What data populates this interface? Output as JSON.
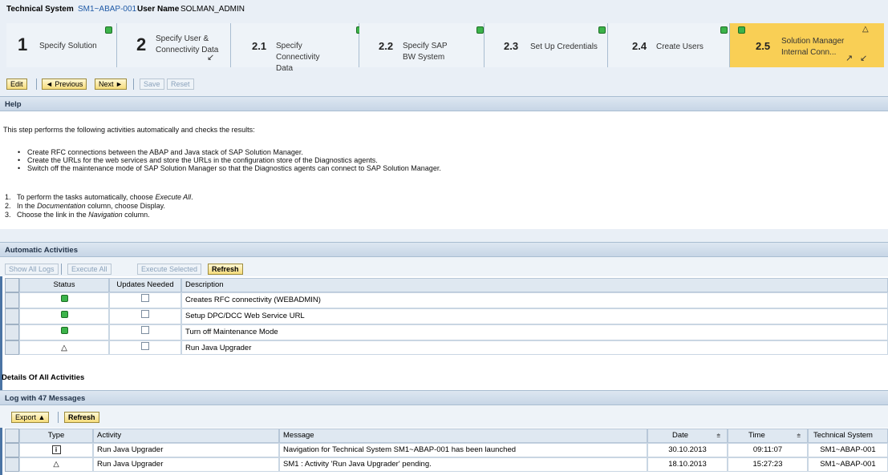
{
  "header": {
    "technical_system_label": "Technical System",
    "technical_system_value": "SM1~ABAP-001",
    "user_name_label": "User Name",
    "user_name_value": "SOLMAN_ADMIN"
  },
  "roadmap": [
    {
      "num": "1",
      "label": "Specify Solution",
      "status": "green"
    },
    {
      "num": "2",
      "label": "Specify User & Connectivity Data",
      "status": "warning"
    },
    {
      "num": "2.1",
      "label": "Specify Connectivity Data",
      "status": "green"
    },
    {
      "num": "2.2",
      "label": "Specify SAP BW System",
      "status": "green"
    },
    {
      "num": "2.3",
      "label": "Set Up Credentials",
      "status": "green"
    },
    {
      "num": "2.4",
      "label": "Create Users",
      "status": "green"
    },
    {
      "num": "2.5",
      "label": "Solution Manager Internal Conn...",
      "status": "warning",
      "active": true
    }
  ],
  "toolbar": {
    "edit": "Edit",
    "previous": "◄ Previous",
    "next": "Next ►",
    "save": "Save",
    "reset": "Reset"
  },
  "help": {
    "title": "Help",
    "intro": "This step performs the following activities automatically and checks the results:",
    "bullets": [
      "Create RFC connections between the ABAP and Java stack of SAP Solution Manager.",
      "Create the URLs for the web services and store the URLs in the configuration store of the Diagnostics agents.",
      "Switch off the maintenance mode of SAP Solution Manager so that the Diagnostics agents can connect to SAP Solution Manager."
    ],
    "steps": [
      {
        "n": "1.",
        "pre": "To perform the tasks automatically, choose ",
        "em": "Execute All",
        "post": "."
      },
      {
        "n": "2.",
        "pre": "In the ",
        "em": "Documentation",
        "post": " column, choose Display."
      },
      {
        "n": "3.",
        "pre": "Choose the link in the ",
        "em": "Navigation",
        "post": " column."
      }
    ]
  },
  "automatic": {
    "title": "Automatic Activities",
    "buttons": {
      "show_all_logs": "Show All Logs",
      "execute_all": "Execute All",
      "execute_selected": "Execute Selected",
      "refresh": "Refresh"
    },
    "columns": [
      "Status",
      "Updates Needed",
      "Description"
    ],
    "rows": [
      {
        "status": "green",
        "description": "Creates RFC connectivity (WEBADMIN)"
      },
      {
        "status": "green",
        "description": "Setup DPC/DCC Web Service URL"
      },
      {
        "status": "green",
        "description": "Turn off Maintenance Mode"
      },
      {
        "status": "warning",
        "description": "Run Java Upgrader"
      }
    ]
  },
  "details_title": "Details Of All Activities",
  "log": {
    "title": "Log with 47 Messages",
    "buttons": {
      "export": "Export ▲",
      "refresh": "Refresh"
    },
    "columns": [
      "Type",
      "Activity",
      "Message",
      "Date",
      "Time",
      "Technical System"
    ],
    "rows": [
      {
        "type": "info",
        "activity": "Run Java Upgrader",
        "message": "Navigation for Technical System SM1~ABAP-001 has been launched",
        "date": "30.10.2013",
        "time": "09:11:07",
        "system": "SM1~ABAP-001"
      },
      {
        "type": "warning",
        "activity": "Run Java Upgrader",
        "message": "SM1 : Activity 'Run Java Upgrader' pending.",
        "date": "18.10.2013",
        "time": "15:27:23",
        "system": "SM1~ABAP-001"
      }
    ]
  },
  "colors": {
    "accent": "#1f5aa6",
    "active_step": "#f9cf55",
    "status_green": "#3cb34a"
  }
}
